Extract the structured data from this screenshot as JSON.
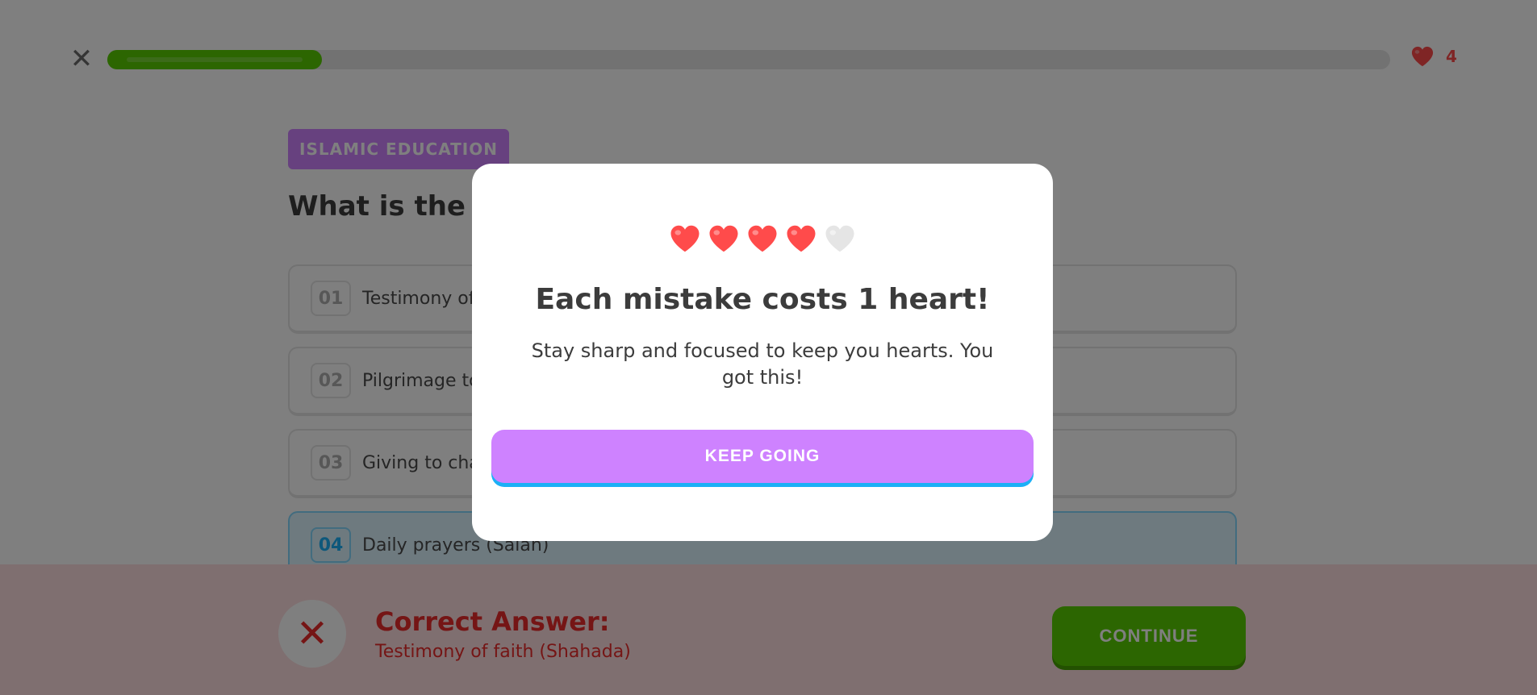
{
  "header": {
    "close_icon": "close-icon",
    "progress_fraction": 0.167,
    "hearts_count": "4",
    "heart_icon": "heart-icon"
  },
  "lesson": {
    "badge": "ISLAMIC EDUCATION",
    "question": "What is the first pillar of Islam?",
    "options": [
      {
        "number": "01",
        "text": "Testimony of faith (Shahada)"
      },
      {
        "number": "02",
        "text": "Pilgrimage to Mecca (Hajj)"
      },
      {
        "number": "03",
        "text": "Giving to charity (Zakat)"
      },
      {
        "number": "04",
        "text": "Daily prayers (Salah)"
      }
    ],
    "selected_option": 3
  },
  "feedback": {
    "title": "Correct Answer:",
    "answer": "Testimony of faith (Shahada)",
    "continue_label": "CONTINUE",
    "icon": "close-icon"
  },
  "modal": {
    "hearts_filled": 4,
    "hearts_total": 5,
    "title": "Each mistake costs 1 heart!",
    "body": "Stay sharp and focused to keep you hearts. You got this!",
    "button_label": "KEEP GOING"
  },
  "colors": {
    "brand_green": "#58cc02",
    "purple": "#ce82ff",
    "heart_red": "#ff4b4b",
    "error_red": "#ea2b2b",
    "blue": "#1cb0f6"
  }
}
